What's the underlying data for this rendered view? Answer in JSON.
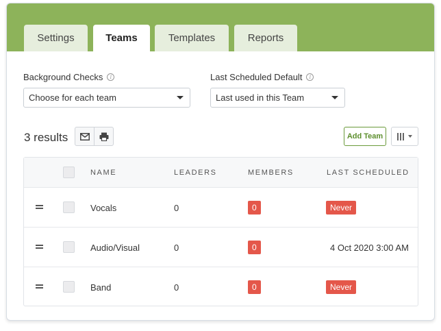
{
  "tabs": [
    {
      "label": "Settings",
      "active": false
    },
    {
      "label": "Teams",
      "active": true
    },
    {
      "label": "Templates",
      "active": false
    },
    {
      "label": "Reports",
      "active": false
    }
  ],
  "filters": {
    "background_checks": {
      "label": "Background Checks",
      "value": "Choose for each team"
    },
    "last_scheduled_default": {
      "label": "Last Scheduled Default",
      "value": "Last used in this Team"
    }
  },
  "toolbar": {
    "results_text": "3 results",
    "email_icon": "envelope-icon",
    "print_icon": "printer-icon",
    "add_team_label": "Add Team",
    "columns_icon": "columns-icon"
  },
  "table": {
    "headers": {
      "name": "NAME",
      "leaders": "LEADERS",
      "members": "MEMBERS",
      "last_scheduled": "LAST SCHEDULED"
    },
    "rows": [
      {
        "name": "Vocals",
        "leaders": "0",
        "members": "0",
        "last_scheduled": "Never",
        "last_scheduled_badge": true
      },
      {
        "name": "Audio/Visual",
        "leaders": "0",
        "members": "0",
        "last_scheduled": "4 Oct 2020 3:00 AM",
        "last_scheduled_badge": false
      },
      {
        "name": "Band",
        "leaders": "0",
        "members": "0",
        "last_scheduled": "Never",
        "last_scheduled_badge": true
      }
    ]
  },
  "colors": {
    "header_green": "#8db35a",
    "badge_red": "#e4574a",
    "add_button_green": "#5c8e2c"
  }
}
